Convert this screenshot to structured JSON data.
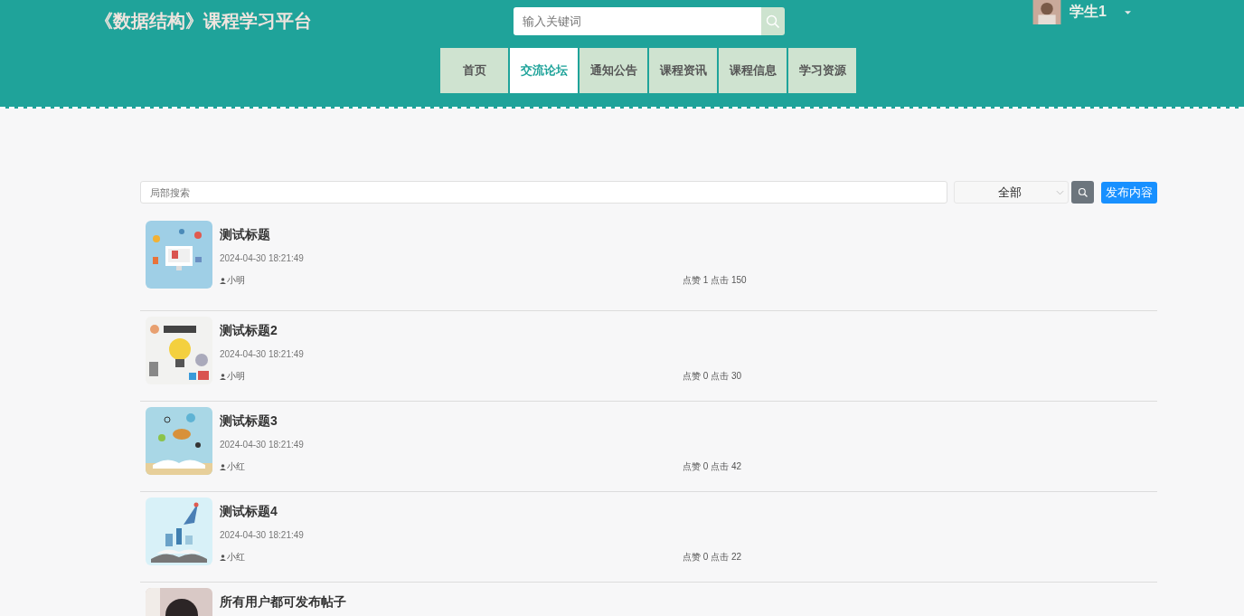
{
  "header": {
    "site_title": "《数据结构》课程学习平台",
    "search": {
      "placeholder": "输入关键词"
    },
    "user": {
      "name": "学生1"
    }
  },
  "nav": [
    {
      "label": "首页",
      "selected": false
    },
    {
      "label": "交流论坛",
      "selected": true
    },
    {
      "label": "通知公告",
      "selected": false
    },
    {
      "label": "课程资讯",
      "selected": false
    },
    {
      "label": "课程信息",
      "selected": false
    },
    {
      "label": "学习资源",
      "selected": false
    }
  ],
  "toolbar": {
    "search": {
      "placeholder": "局部搜索"
    },
    "category": {
      "value": "全部"
    },
    "publish_button": "发布内容"
  },
  "posts": [
    {
      "title": "测试标题",
      "date": "2024-04-30 18:21:49",
      "author": "小明",
      "stats": "点赞 1 点击 150"
    },
    {
      "title": "测试标题2",
      "date": "2024-04-30 18:21:49",
      "author": "小明",
      "stats": "点赞 0 点击 30"
    },
    {
      "title": "测试标题3",
      "date": "2024-04-30 18:21:49",
      "author": "小红",
      "stats": "点赞 0 点击 42"
    },
    {
      "title": "测试标题4",
      "date": "2024-04-30 18:21:49",
      "author": "小红",
      "stats": "点赞 0 点击 22"
    },
    {
      "title": "所有用户都可发布帖子"
    }
  ]
}
